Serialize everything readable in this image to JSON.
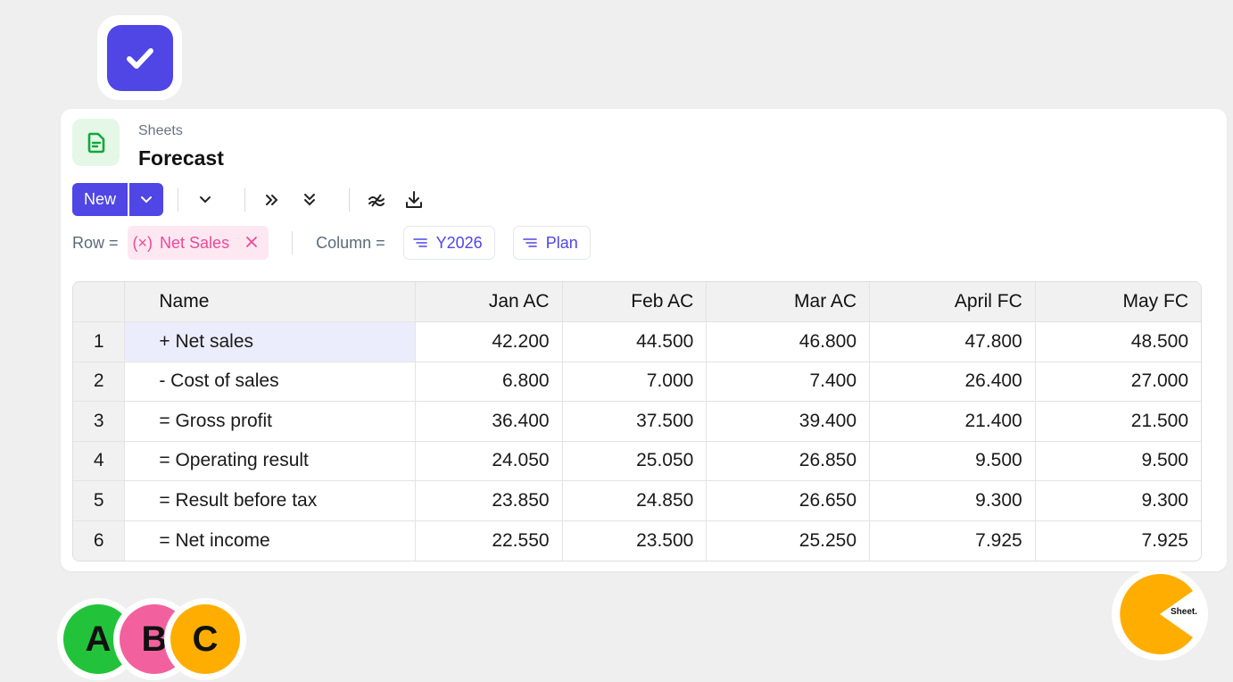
{
  "header": {
    "app_name": "Sheets",
    "doc_title": "Forecast"
  },
  "toolbar": {
    "new_label": "New",
    "icons": [
      "chevron-down-icon",
      "chevron-double-right-icon",
      "chevron-double-down-icon",
      "approx-equal-icon",
      "download-icon"
    ]
  },
  "filters": {
    "row_label": "Row =",
    "row_chip": "Net Sales",
    "row_chip_prefix": "(×)",
    "column_label": "Column =",
    "column_chips": [
      "Y2026",
      "Plan"
    ]
  },
  "table": {
    "columns": [
      "Name",
      "Jan AC",
      "Feb AC",
      "Mar AC",
      "April FC",
      "May FC"
    ],
    "rows": [
      {
        "idx": "1",
        "name": "+ Net sales",
        "values": [
          "42.200",
          "44.500",
          "46.800",
          "47.800",
          "48.500"
        ]
      },
      {
        "idx": "2",
        "name": "- Cost of sales",
        "values": [
          "6.800",
          "7.000",
          "7.400",
          "26.400",
          "27.000"
        ]
      },
      {
        "idx": "3",
        "name": "= Gross profit",
        "values": [
          "36.400",
          "37.500",
          "39.400",
          "21.400",
          "21.500"
        ]
      },
      {
        "idx": "4",
        "name": "= Operating result",
        "values": [
          "24.050",
          "25.050",
          "26.850",
          "9.500",
          "9.500"
        ]
      },
      {
        "idx": "5",
        "name": "= Result before tax",
        "values": [
          "23.850",
          "24.850",
          "26.650",
          "9.300",
          "9.300"
        ]
      },
      {
        "idx": "6",
        "name": "= Net income",
        "values": [
          "22.550",
          "23.500",
          "25.250",
          "7.925",
          "7.925"
        ]
      }
    ]
  },
  "avatars": [
    {
      "letter": "A",
      "color": "#22c33a"
    },
    {
      "letter": "B",
      "color": "#f2619e"
    },
    {
      "letter": "C",
      "color": "#ffae00"
    }
  ],
  "logo": {
    "text": "Sheet.",
    "color": "#ffae00"
  },
  "colors": {
    "accent": "#4f46e5",
    "chip_pink": "#ec4899",
    "selected_cell": "#ecedfc"
  }
}
